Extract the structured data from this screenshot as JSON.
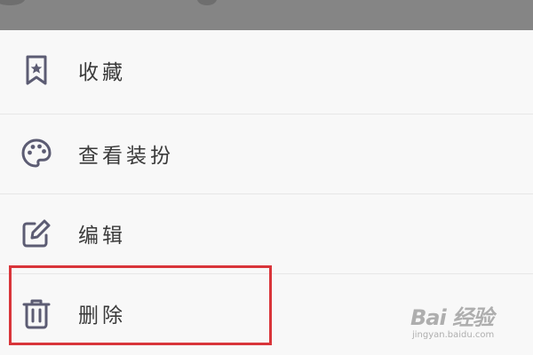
{
  "menu": {
    "items": [
      {
        "label": "收藏",
        "icon": "bookmark-star-icon"
      },
      {
        "label": "查看装扮",
        "icon": "palette-icon"
      },
      {
        "label": "编辑",
        "icon": "edit-icon"
      },
      {
        "label": "删除",
        "icon": "trash-icon"
      }
    ]
  },
  "watermark": {
    "brand": "Bai 经验",
    "url": "jingyan.baidu.com"
  },
  "colors": {
    "icon": "#5c5c73",
    "highlight": "#d9353a",
    "text": "#3a3a3a"
  }
}
